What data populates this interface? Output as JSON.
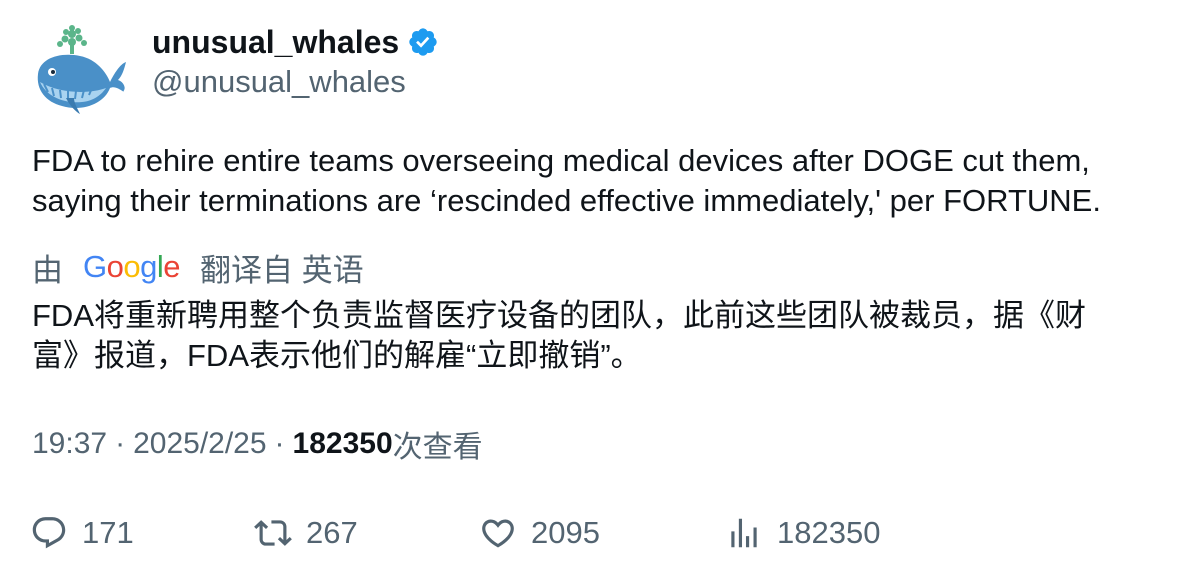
{
  "user": {
    "display_name": "unusual_whales",
    "handle": "@unusual_whales",
    "verified": true,
    "verified_color": "#1d9bf0",
    "avatar_icon": "whale-logo-icon"
  },
  "tweet": {
    "text_line1": "FDA to rehire entire teams overseeing medical devices after DOGE cut them,",
    "text_line2": "saying their terminations are ‘rescinded effective immediately,' per FORTUNE."
  },
  "translation": {
    "prefix": "由",
    "provider": "Google",
    "suffix": "翻译自 英语",
    "line1": "FDA将重新聘用整个负责监督医疗设备的团队，此前这些团队被裁员，据《财",
    "line2": "富》报道，FDA表示他们的解雇“立即撤销”。"
  },
  "meta": {
    "time": "19:37",
    "separator": "·",
    "date": "2025/2/25",
    "views": "182350",
    "views_label": "次查看"
  },
  "actions": {
    "replies": "171",
    "retweets": "267",
    "likes": "2095",
    "views": "182350"
  }
}
